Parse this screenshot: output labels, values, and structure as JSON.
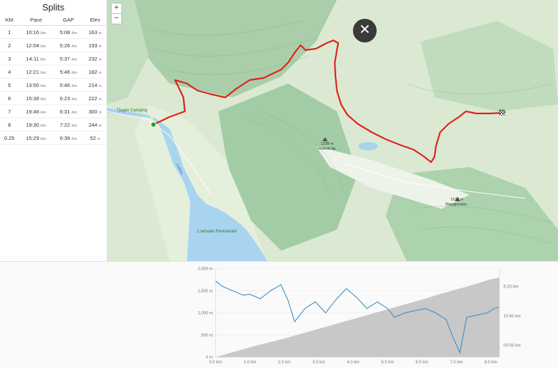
{
  "splits": {
    "title": "Splits",
    "headers": [
      "KM",
      "Pace",
      "GAP",
      "Elev"
    ],
    "pace_unit": "/km",
    "elev_unit": "m",
    "rows": [
      {
        "km": "1",
        "pace": "10:16",
        "gap": "5:08",
        "elev": "163"
      },
      {
        "km": "2",
        "pace": "12:04",
        "gap": "5:26",
        "elev": "193"
      },
      {
        "km": "3",
        "pace": "14:11",
        "gap": "5:37",
        "elev": "232"
      },
      {
        "km": "4",
        "pace": "12:21",
        "gap": "5:46",
        "elev": "182"
      },
      {
        "km": "5",
        "pace": "13:50",
        "gap": "5:46",
        "elev": "214"
      },
      {
        "km": "6",
        "pace": "15:38",
        "gap": "6:23",
        "elev": "222"
      },
      {
        "km": "7",
        "pace": "19:48",
        "gap": "6:31",
        "elev": "300"
      },
      {
        "km": "8",
        "pace": "19:30",
        "gap": "7:22",
        "elev": "244"
      },
      {
        "km": "0.25",
        "pace": "15:29",
        "gap": "6:39",
        "elev": "52"
      }
    ]
  },
  "map": {
    "zoom_in": "+",
    "zoom_out": "−",
    "close_icon": "close-icon",
    "labels": {
      "camping": "Tjugen Camping",
      "lake": "Loenvatn Feriesenter",
      "peak1_elev": "1238 m",
      "peak1_name": "Veslesk.lla",
      "peak2_elev": "1572 m",
      "peak2_name": "Blanglunsbu",
      "river": "Loelva"
    },
    "colors": {
      "route": "#e0211b",
      "start": "#1ea21e",
      "water": "#a8d4ef"
    }
  },
  "chart_data": {
    "type": "line",
    "x_ticks": [
      "0.0 km",
      "1.0 km",
      "2.0 km",
      "3.0 km",
      "4.0 km",
      "5.0 km",
      "6.0 km",
      "7.0 km",
      "8.0 km"
    ],
    "y_ticks_left": [
      "0 m",
      "500 m",
      "1,000 m",
      "1,500 m",
      "2,000 m"
    ],
    "y_ticks_right": [
      "00:00 km",
      "10:40 km",
      "6:20 km"
    ],
    "xlim": [
      0,
      8.25
    ],
    "ylim": [
      0,
      2000
    ],
    "series": [
      {
        "kind": "area",
        "color": "#c8c8c8",
        "x": [
          0,
          0.5,
          1,
          1.5,
          2,
          2.5,
          3,
          3.5,
          4,
          4.5,
          5,
          5.5,
          6,
          6.5,
          7,
          7.5,
          8,
          8.25
        ],
        "y": [
          0,
          110,
          220,
          320,
          420,
          530,
          640,
          750,
          860,
          970,
          1080,
          1190,
          1300,
          1420,
          1530,
          1640,
          1760,
          1800
        ]
      },
      {
        "kind": "line",
        "color": "#3a8fc6",
        "x": [
          0,
          0.2,
          0.5,
          0.8,
          1.0,
          1.3,
          1.6,
          1.9,
          2.1,
          2.3,
          2.6,
          2.9,
          3.2,
          3.5,
          3.8,
          4.1,
          4.4,
          4.7,
          5.0,
          5.2,
          5.5,
          5.8,
          6.1,
          6.4,
          6.7,
          6.9,
          7.1,
          7.3,
          7.6,
          7.9,
          8.1,
          8.25
        ],
        "y": [
          1720,
          1600,
          1500,
          1400,
          1420,
          1320,
          1500,
          1640,
          1300,
          800,
          1100,
          1250,
          1000,
          1300,
          1550,
          1350,
          1100,
          1250,
          1100,
          900,
          1000,
          1050,
          1100,
          1000,
          850,
          450,
          100,
          900,
          950,
          1000,
          1100,
          1130
        ]
      }
    ]
  }
}
